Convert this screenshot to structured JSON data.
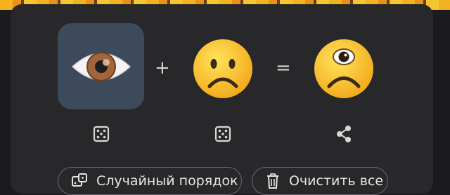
{
  "window": {
    "background": "#1b1b1d",
    "card_color": "#28282a"
  },
  "mixer": {
    "left_emoji": {
      "icon": "eye-emoji",
      "selected": true,
      "tile_color": "#3d4a5b"
    },
    "plus_symbol": "+",
    "right_emoji": {
      "icon": "frowning-face-emoji"
    },
    "equals_symbol": "=",
    "result_emoji": {
      "icon": "cyclops-frowning-face-emoji"
    }
  },
  "controls": {
    "left_randomize": {
      "icon": "dice-icon"
    },
    "right_randomize": {
      "icon": "dice-icon"
    },
    "share": {
      "icon": "share-icon"
    }
  },
  "actions": {
    "shuffle_label": "Случайный порядок",
    "shuffle_icon": "dice-icon",
    "clear_label": "Очистить все",
    "clear_icon": "trash-icon"
  }
}
